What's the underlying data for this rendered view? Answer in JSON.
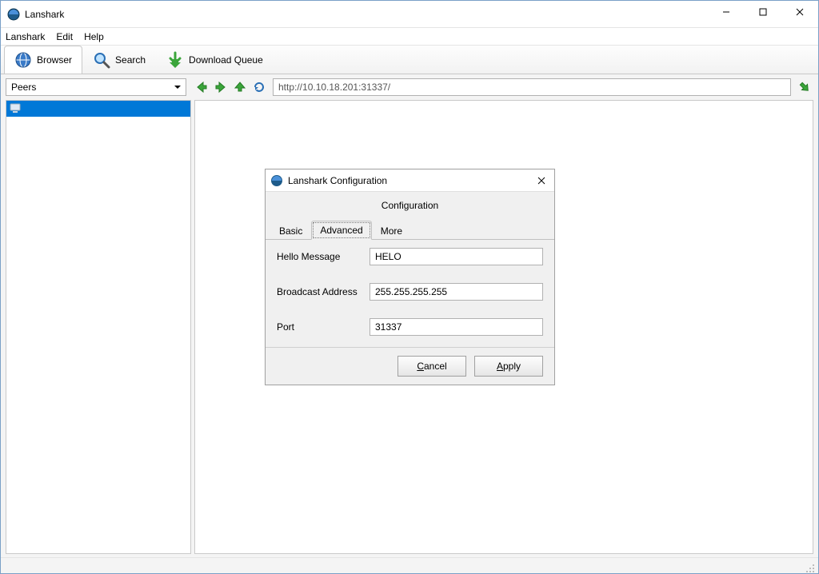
{
  "window": {
    "title": "Lanshark",
    "minimize_label": "Minimize",
    "maximize_label": "Maximize",
    "close_label": "Close"
  },
  "menu": {
    "items": [
      "Lanshark",
      "Edit",
      "Help"
    ]
  },
  "toolbar": {
    "tabs": [
      {
        "label": "Browser",
        "icon": "globe-icon",
        "active": true
      },
      {
        "label": "Search",
        "icon": "magnifier-icon",
        "active": false
      },
      {
        "label": "Download Queue",
        "icon": "download-icon",
        "active": false
      }
    ]
  },
  "nav": {
    "url_value": "http://10.10.18.201:31337/",
    "back_label": "Back",
    "forward_label": "Forward",
    "up_label": "Up",
    "refresh_label": "Refresh",
    "go_label": "Go"
  },
  "sidebar": {
    "dropdown_label": "Peers",
    "peers": [
      {
        "label": ""
      }
    ]
  },
  "dialog": {
    "title": "Lanshark Configuration",
    "heading": "Configuration",
    "tabs": [
      {
        "label": "Basic",
        "active": false
      },
      {
        "label": "Advanced",
        "active": true
      },
      {
        "label": "More",
        "active": false
      }
    ],
    "fields": {
      "hello_label": "Hello Message",
      "hello_value": "HELO",
      "broadcast_label": "Broadcast Address",
      "broadcast_value": "255.255.255.255",
      "port_label": "Port",
      "port_value": "31337"
    },
    "buttons": {
      "cancel": "Cancel",
      "apply": "Apply"
    }
  }
}
